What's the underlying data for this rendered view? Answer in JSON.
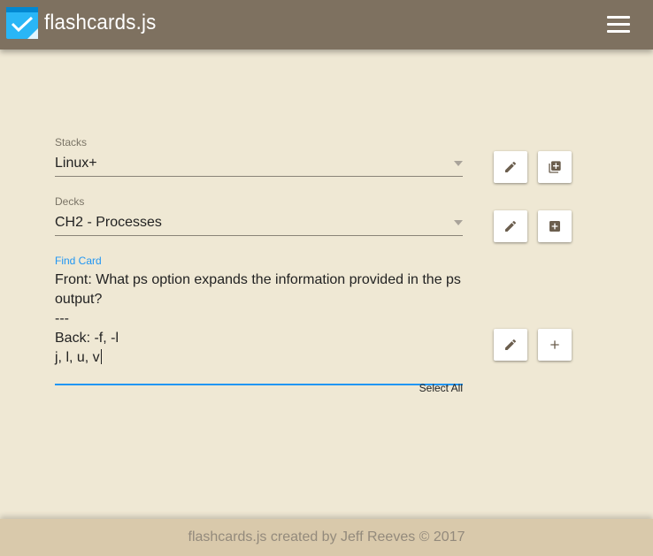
{
  "header": {
    "title": "flashcards.js",
    "logo_icon": "flashcard-check-icon",
    "menu_icon": "hamburger-menu-icon",
    "bg_color": "#7e7160"
  },
  "stacks": {
    "label": "Stacks",
    "selected": "Linux+",
    "edit_icon": "pencil-icon",
    "add_icon": "add-stack-icon"
  },
  "decks": {
    "label": "Decks",
    "selected": "CH2 - Processes",
    "edit_icon": "pencil-icon",
    "add_icon": "add-box-icon"
  },
  "find_card": {
    "label": "Find Card",
    "value": "Front: What ps option expands the information provided in the ps output?\n---\nBack: -f, -l\nj, l, u, v",
    "select_all_label": "Select All",
    "edit_icon": "pencil-icon",
    "add_icon": "plus-icon",
    "accent_color": "#2196f3"
  },
  "footer": {
    "text": "flashcards.js created by Jeff Reeves © 2017",
    "bg_color": "#d9c9ab"
  }
}
